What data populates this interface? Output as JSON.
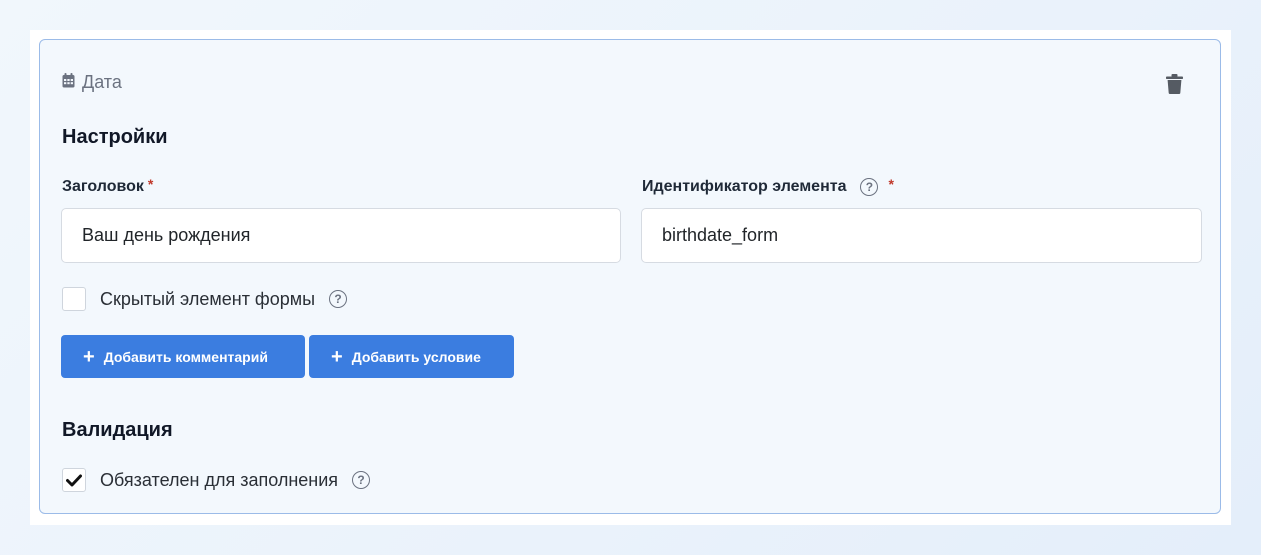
{
  "element": {
    "type_label": "Дата",
    "type_icon": "calendar-icon",
    "delete_icon": "trash-icon"
  },
  "settings": {
    "title": "Настройки",
    "heading_field": {
      "label": "Заголовок",
      "required_mark": "*",
      "value": "Ваш день рождения"
    },
    "id_field": {
      "label": "Идентификатор элемента",
      "required_mark": "*",
      "help": "?",
      "value": "birthdate_form"
    },
    "hidden_checkbox": {
      "label": "Скрытый элемент формы",
      "checked": false,
      "help": "?"
    },
    "buttons": {
      "add_comment": "Добавить комментарий",
      "add_condition": "Добавить условие",
      "plus": "+"
    }
  },
  "validation": {
    "title": "Валидация",
    "required_checkbox": {
      "label": "Обязателен для заполнения",
      "checked": true,
      "help": "?"
    }
  },
  "colors": {
    "accent": "#3b7de0",
    "card_border": "#9bbbe8",
    "required": "#c0392b"
  }
}
